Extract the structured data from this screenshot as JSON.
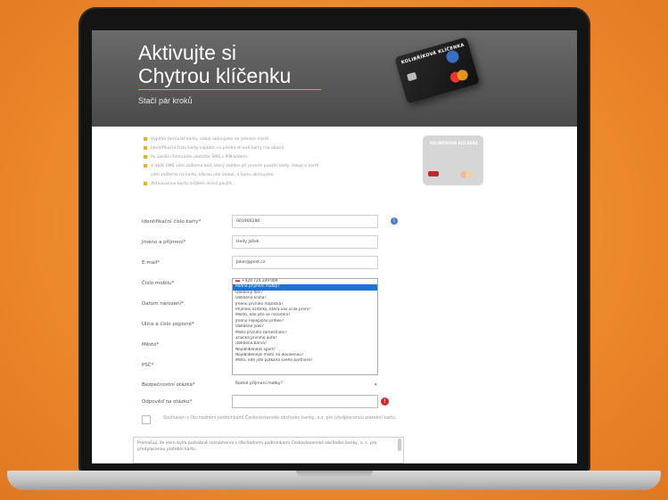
{
  "hero": {
    "title_line1": "Aktivujte si",
    "title_line2": "Chytrou klíčenku",
    "subtitle": "Stačí pár kroků",
    "card_label": "KOLIBŘÍKOVÁ KLÍČENKA"
  },
  "side_card": {
    "label": "KOLIBŘÍKOVÁ KLÍČENKA"
  },
  "bullets": [
    "Vyplňte formulář kartu, údaje aktivujete na jednom místě.",
    "Identifikační číslo karty najdete na přední straně karty (na obalu).",
    "Po zaslání formuláře obdržíte SMS s PIN kódem.",
    "V další SMS vám zašleme kód, který zadáte při prvním použití karty. Údaje o kartě",
    "vám zašleme na kartu, kterou jste zadali, a kartu aktivujete.",
    "Aktivovanou kartu můžete ihned použít."
  ],
  "form": {
    "card_id_label": "Identifikační číslo karty*",
    "card_id_value": "001900280",
    "name_label": "Jméno a příjmení*",
    "name_value": "Hedy Jašek",
    "email_label": "E-mail*",
    "email_value": "Joker@post.cz",
    "phone_label": "Číslo mobilu*",
    "phone_value": "+420 724 209 009",
    "dob_label": "Datum narození*",
    "street_label": "Ulice a číslo popisné*",
    "city_label": "Město*",
    "zip_label": "PSČ*",
    "question_label": "Bezpečnostní otázka*",
    "question_value": "Rodné příjmení matky?",
    "answer_label": "Odpověď na otázku*",
    "answer_value": ""
  },
  "dropdown_options": [
    "Rodné příjmení matky?",
    "Oblíbený film?",
    "Oblíbená kniha?",
    "Jméno prvního mazlíčka?",
    "Příjmení učitelky, která vás učila první?",
    "Město, kde jste se narodil/a?",
    "Jméno nejlepšího přítele?",
    "Oblíbené jídlo?",
    "Místo prvního zaměstnání?",
    "Značka prvního auta?",
    "Oblíbená barva?",
    "Nejoblíbenější sport?",
    "Nejoblíbenější místo na dovolenou?",
    "Místo, kde jste potkal/a svého partnera?"
  ],
  "dropdown_selected_index": 0,
  "consent_text": "Souhlasím s Obchodními podmínkami Československé obchodní banky, a.s. pro předplacenou platební kartu.",
  "textarea_text": "Prohlašuji, že jsem byl/a podrobně seznámen/a s Obchodními podmínkami Československé obchodní banky, a. s. pro předplacenou platební kartu.",
  "colors": {
    "background": "#ee8a2e",
    "hero": "#5a5a5a",
    "bullet_accent": "#f0b400",
    "error": "#d9262b",
    "info": "#4a7ec8",
    "selection": "#1e73d2"
  }
}
